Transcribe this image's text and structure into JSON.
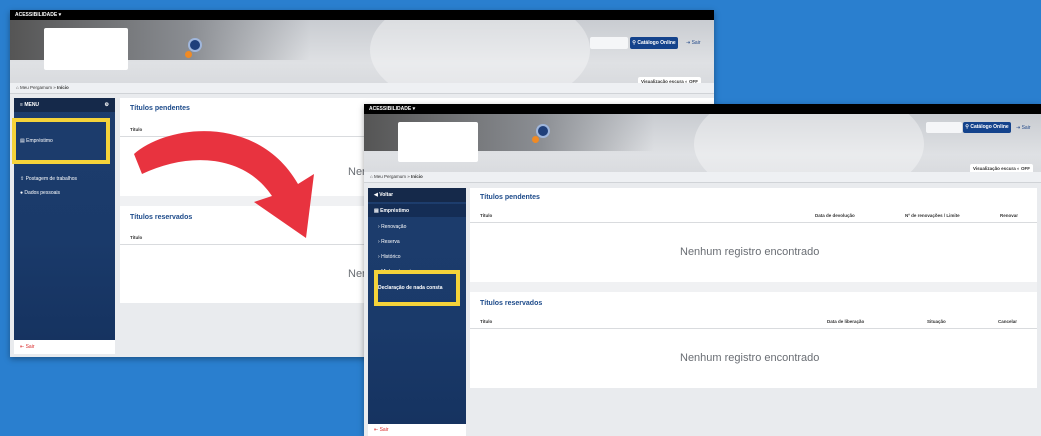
{
  "accessibility_label": "ACESSIBILIDADE ▾",
  "catalog_button": "Catálogo Online",
  "sair_top": "Sair",
  "dark_mode_label": "Visualização escura",
  "dark_mode_state": "OFF",
  "breadcrumb": {
    "home": "Meu Pergamum",
    "sep": "»",
    "current": "Início"
  },
  "pin_count": "0",
  "screen1": {
    "menu_label": "MENU",
    "sidebar_items": [
      "Empréstimo",
      "Postagem de trabalhos",
      "Dados pessoais"
    ],
    "sair": "Sair",
    "pending_title": "Títulos pendentes",
    "pending_col": "Título",
    "pending_empty": "Nenh",
    "reserved_title": "Títulos reservados",
    "reserved_col": "Título",
    "reserved_empty": "Neni"
  },
  "screen2": {
    "back_label": "Voltar",
    "section": "Empréstimo",
    "sub_items": [
      "Renovação",
      "Reserva",
      "Histórico",
      "Minhas terceiras"
    ],
    "highlight_item": "Declaração de nada consta",
    "sair": "Sair",
    "pending_title": "Títulos pendentes",
    "pending_cols": [
      "Título",
      "Data de devolução",
      "Nº de renovações / Limite",
      "Renovar"
    ],
    "pending_empty": "Nenhum registro encontrado",
    "reserved_title": "Títulos reservados",
    "reserved_cols": [
      "Título",
      "Data de liberação",
      "Situação",
      "Cancelar"
    ],
    "reserved_empty": "Nenhum registro encontrado"
  },
  "colors": {
    "background": "#2a7fcf",
    "sidebar": "#1d3d6d",
    "highlight": "#f5d33a",
    "arrow": "#e8333f",
    "accent": "#14438c"
  }
}
